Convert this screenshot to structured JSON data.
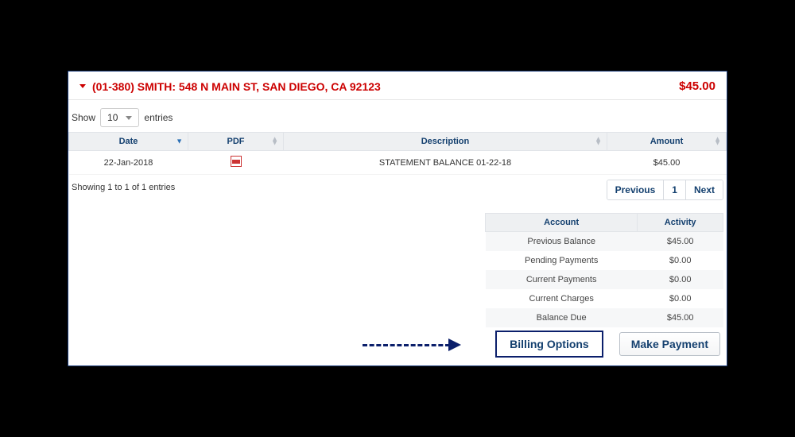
{
  "header": {
    "account_title": "(01-380) SMITH: 548 N MAIN ST, SAN DIEGO, CA 92123",
    "amount": "$45.00"
  },
  "length": {
    "show_label": "Show",
    "value": "10",
    "entries_label": "entries"
  },
  "table": {
    "columns": {
      "date": "Date",
      "pdf": "PDF",
      "description": "Description",
      "amount": "Amount"
    },
    "rows": [
      {
        "date": "22-Jan-2018",
        "description": "STATEMENT BALANCE 01-22-18",
        "amount": "$45.00"
      }
    ]
  },
  "info": {
    "showing": "Showing 1 to 1 of 1 entries"
  },
  "pager": {
    "previous": "Previous",
    "page": "1",
    "next": "Next"
  },
  "summary": {
    "columns": {
      "account": "Account",
      "activity": "Activity"
    },
    "rows": [
      {
        "label": "Previous Balance",
        "value": "$45.00"
      },
      {
        "label": "Pending Payments",
        "value": "$0.00"
      },
      {
        "label": "Current Payments",
        "value": "$0.00"
      },
      {
        "label": "Current Charges",
        "value": "$0.00"
      },
      {
        "label": "Balance Due",
        "value": "$45.00"
      }
    ]
  },
  "buttons": {
    "billing_options": "Billing Options",
    "make_payment": "Make Payment"
  }
}
